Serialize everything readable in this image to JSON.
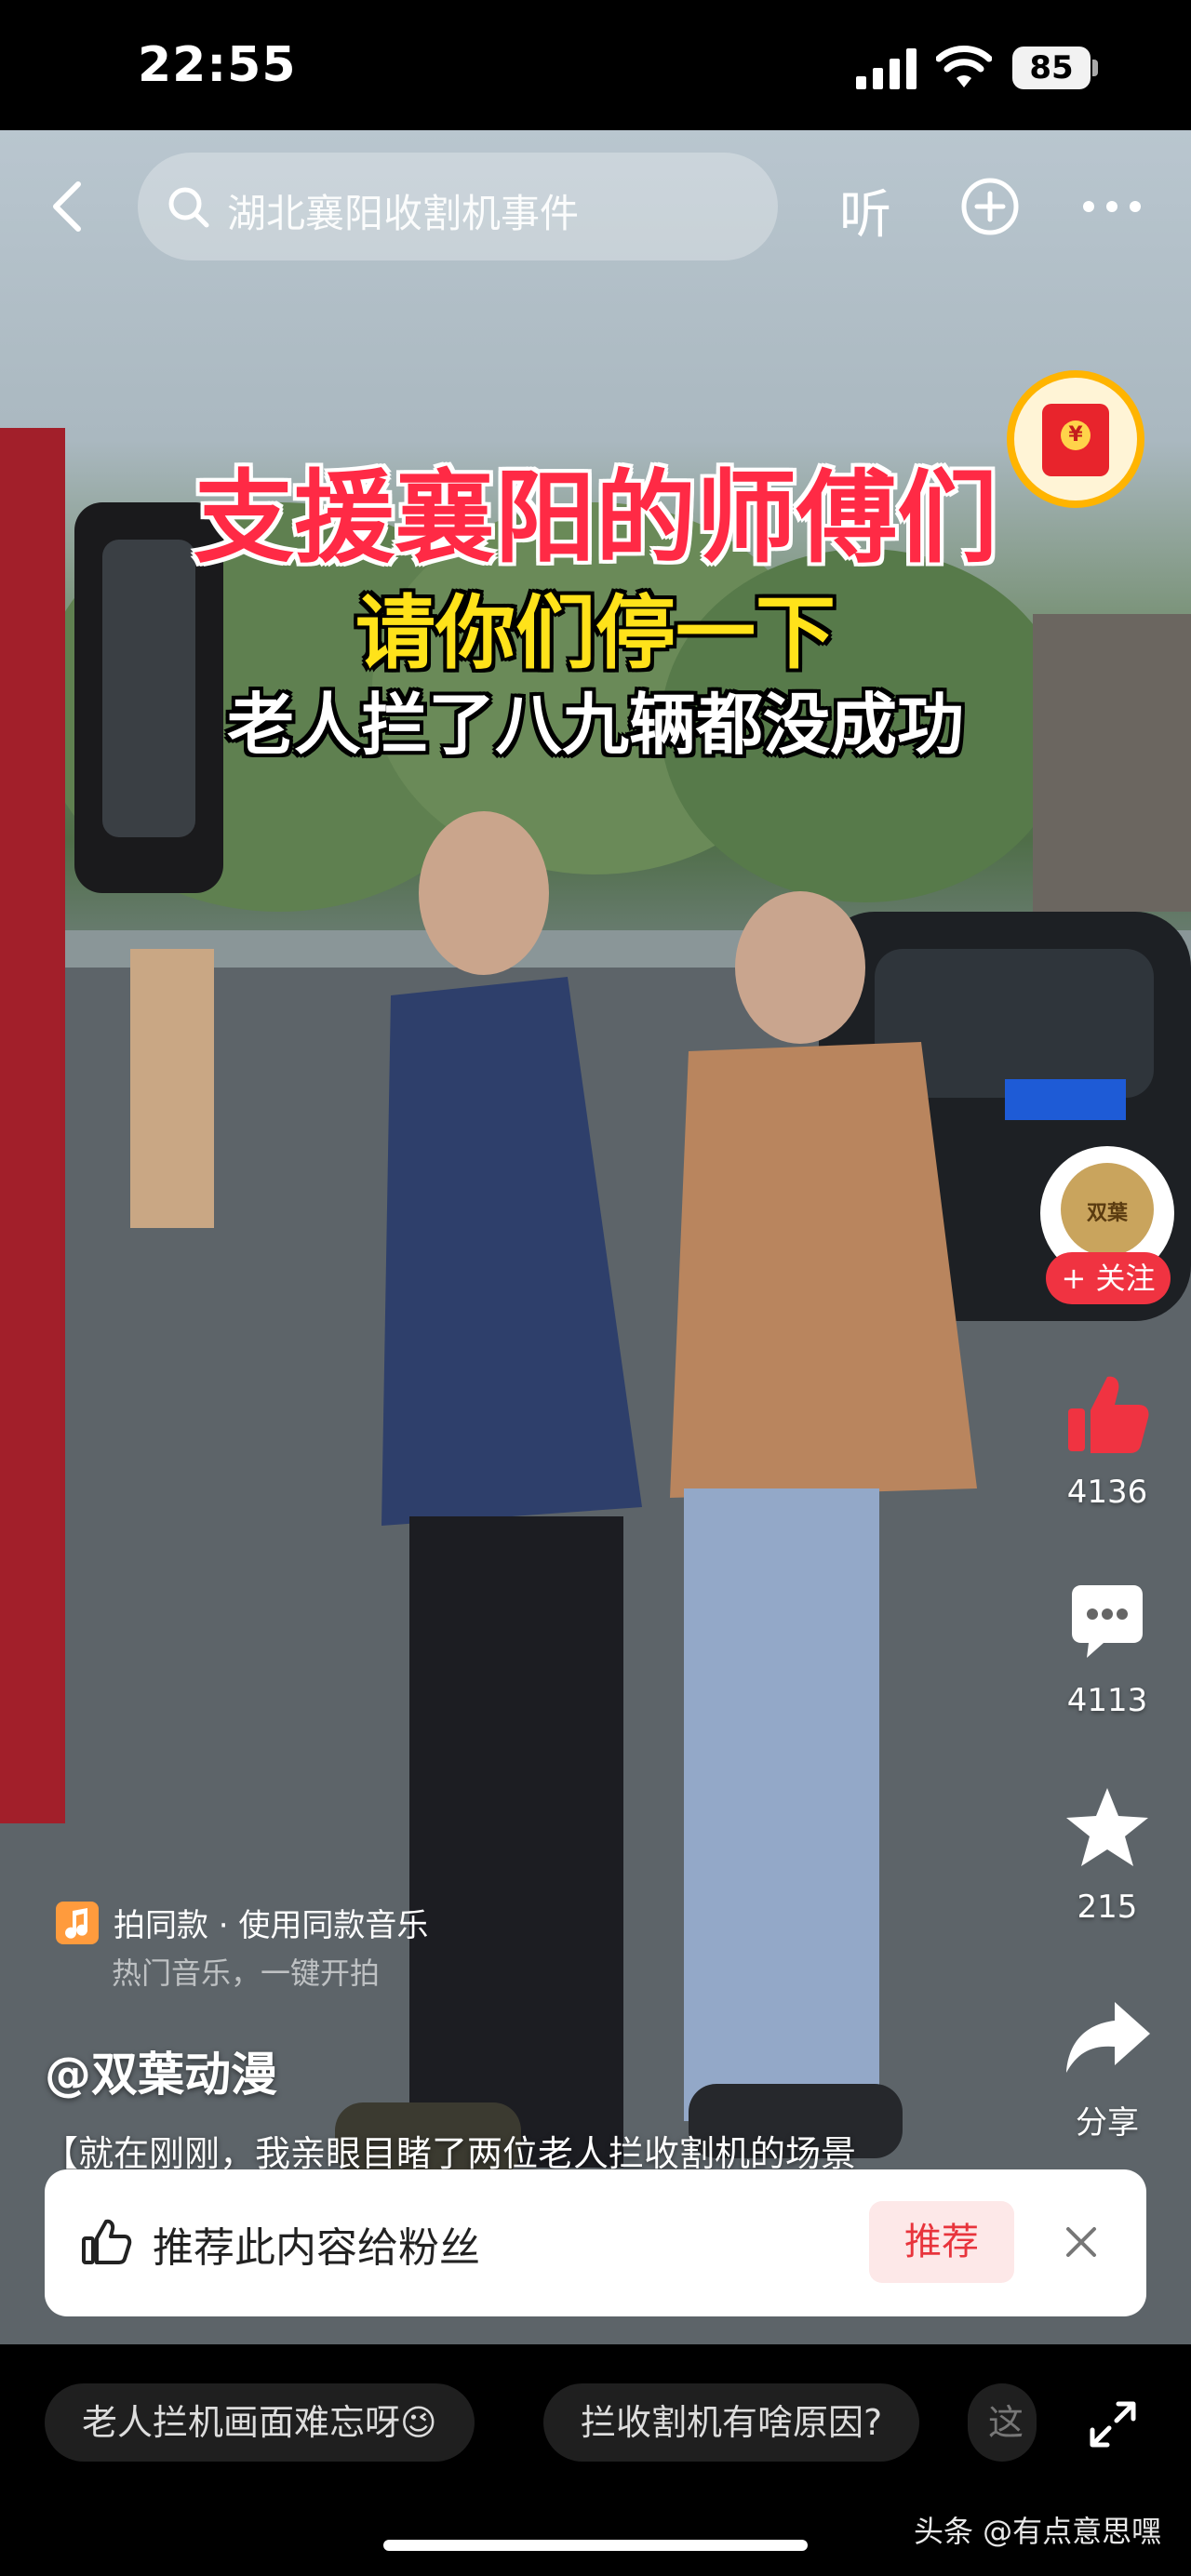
{
  "status_bar": {
    "time": "22:55",
    "battery": "85"
  },
  "top_bar": {
    "search_text": "湖北襄阳收割机事件",
    "listen_label": "听"
  },
  "captions": {
    "line1": "支援襄阳的师傅们",
    "line2": "请你们停一下",
    "line3": "老人拦了八九辆都没成功"
  },
  "rail": {
    "follow_label": "+ 关注",
    "likes": "4136",
    "comments": "4113",
    "favorites": "215",
    "share_label": "分享"
  },
  "music": {
    "line1": "拍同款 · 使用同款音乐",
    "line2": "热门音乐，一键开拍"
  },
  "author": "@双葉动漫",
  "description": "【就在刚刚，我亲眼目睹了两位老人拦收割机的场景",
  "recommend": {
    "text": "推荐此内容给粉丝",
    "button": "推荐"
  },
  "chips": [
    "老人拦机画面难忘呀😉",
    "拦收割机有啥原因?",
    "这"
  ],
  "watermark": "头条 @有点意思嘿",
  "colors": {
    "accent_red": "#f03341",
    "caption_red": "#ff2a45",
    "caption_yellow": "#ffe21a"
  }
}
